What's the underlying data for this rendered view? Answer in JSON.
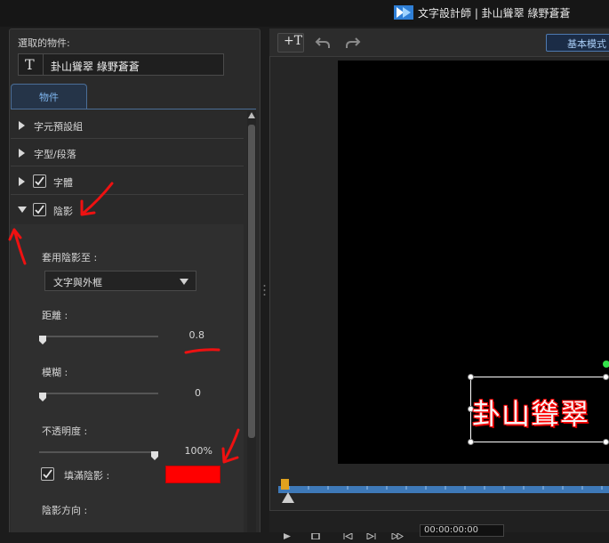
{
  "window": {
    "title": "文字設計師 | 卦山聳翠 綠野蒼蒼"
  },
  "selection": {
    "label": "選取的物件:",
    "text": "卦山聳翠 綠野蒼蒼"
  },
  "tabs": [
    {
      "label": "物件",
      "active": true
    }
  ],
  "sections": [
    {
      "label": "字元預設組",
      "expanded": false,
      "has_checkbox": false
    },
    {
      "label": "字型/段落",
      "expanded": false,
      "has_checkbox": false
    },
    {
      "label": "字體",
      "expanded": false,
      "has_checkbox": true,
      "checked": true
    },
    {
      "label": "陰影",
      "expanded": true,
      "has_checkbox": true,
      "checked": true
    }
  ],
  "shadow": {
    "apply_to_label": "套用陰影至 :",
    "apply_to_value": "文字與外框",
    "distance_label": "距離 :",
    "distance_value": "0.8",
    "distance_fraction": 0.0,
    "blur_label": "模糊 :",
    "blur_value": "0",
    "blur_fraction": 0.0,
    "opacity_label": "不透明度 :",
    "opacity_value": "100%",
    "opacity_fraction": 1.0,
    "fill_label": "填滿陰影 :",
    "fill_checked": true,
    "fill_color": "#ff0000",
    "direction_label": "陰影方向 :"
  },
  "toolbar": {
    "basic_mode_label": "基本模式"
  },
  "canvas": {
    "text": "卦山聳翠"
  },
  "timeline": {
    "progress": 0.0,
    "time": "00:00:00:00"
  },
  "colors": {
    "accent": "#4b6e97",
    "timeline": "#3e79b8",
    "annotation": "#ff0000"
  }
}
